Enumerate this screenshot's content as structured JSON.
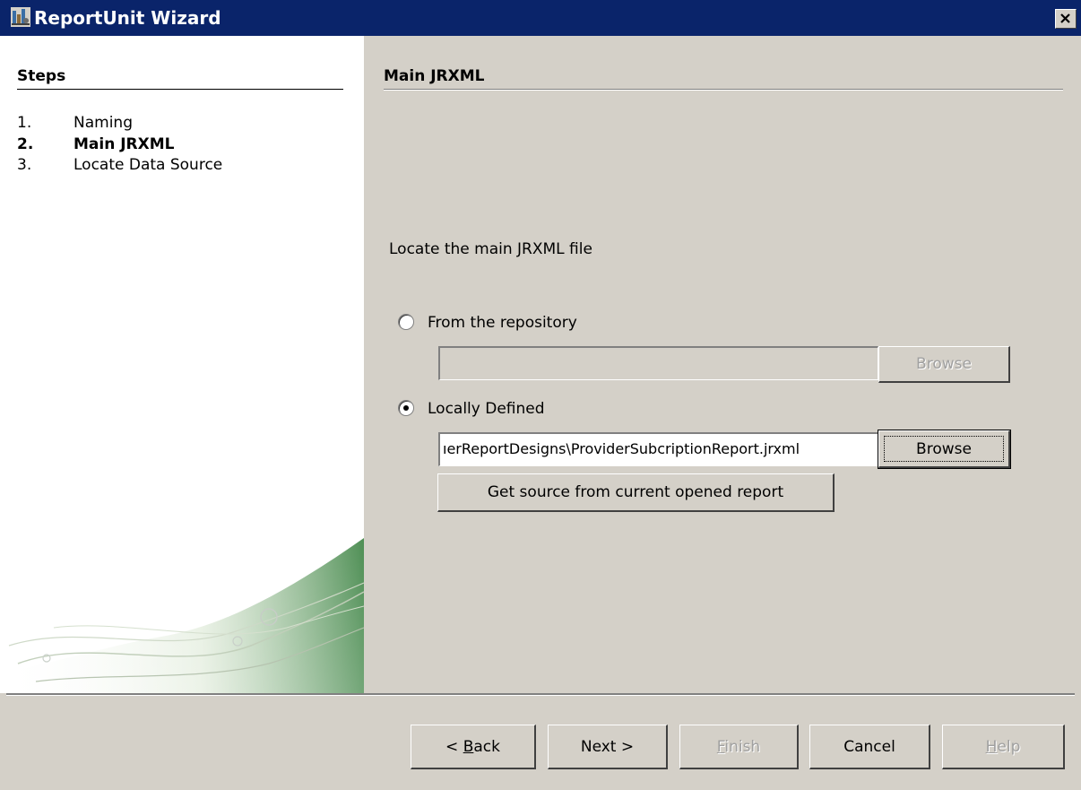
{
  "window": {
    "title": "ReportUnit Wizard",
    "icon": "wizard-app-icon",
    "close_icon": "close-icon"
  },
  "steps": {
    "heading": "Steps",
    "items": [
      {
        "num": "1.",
        "label": "Naming",
        "current": false
      },
      {
        "num": "2.",
        "label": "Main JRXML",
        "current": true
      },
      {
        "num": "3.",
        "label": "Locate Data Source",
        "current": false
      }
    ]
  },
  "main": {
    "heading": "Main JRXML",
    "instruction": "Locate the main JRXML file",
    "from_repository": {
      "label": "From the repository",
      "selected": false,
      "value": "",
      "browse_label": "Browse",
      "browse_enabled": false
    },
    "locally_defined": {
      "label": "Locally Defined",
      "selected": true,
      "value": "C:\\Users\\ProviderReportDesigns\\ProviderSubcriptionReport.jrxml",
      "visible_value": "ıerReportDesigns\\ProviderSubcriptionReport.jrxml",
      "browse_label": "Browse",
      "browse_enabled": true
    },
    "get_source_label": "Get source from current opened report"
  },
  "footer": {
    "back": {
      "pre": "< ",
      "mnemonic": "B",
      "post": "ack",
      "enabled": true
    },
    "next": {
      "label": "Next >",
      "enabled": true
    },
    "finish": {
      "mnemonic": "F",
      "post": "inish",
      "enabled": false
    },
    "cancel": {
      "label": "Cancel",
      "enabled": true
    },
    "help": {
      "mnemonic": "H",
      "post": "elp",
      "enabled": false
    }
  },
  "colors": {
    "titlebar": "#0a246a",
    "dialog_bg": "#d4d0c8",
    "panel_bg": "#ffffff",
    "swoosh_green": "#5a9a5a"
  }
}
